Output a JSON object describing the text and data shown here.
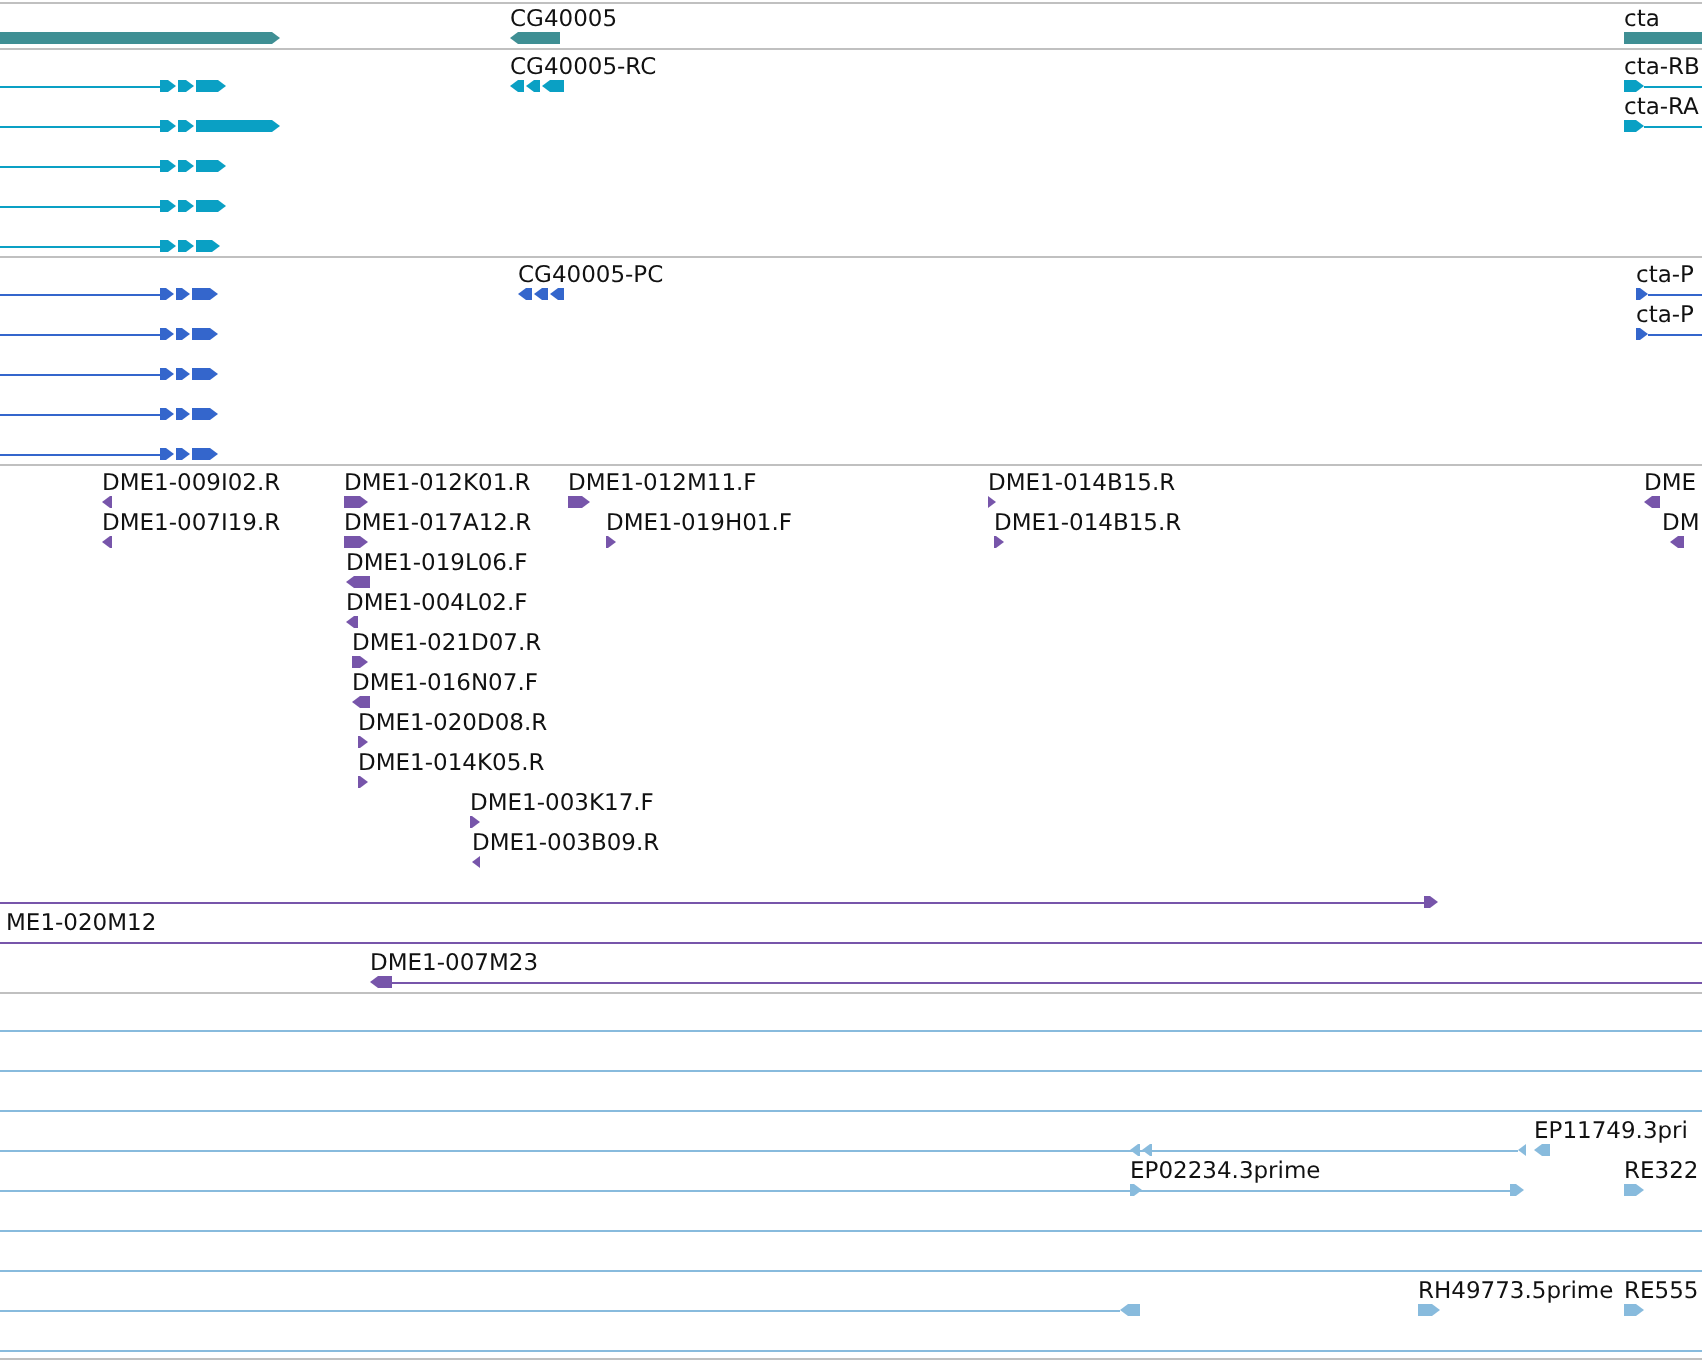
{
  "tracks": [
    {
      "kind": "gene",
      "color": "#3f8f94",
      "features": [
        {
          "reverse": false
        },
        {
          "label": "CG40005",
          "reverse": true
        },
        {
          "label": "cta"
        }
      ]
    },
    {
      "kind": "transcript",
      "color": "#0aa0c4",
      "features": [
        {
          "reverse": false
        },
        {
          "label": "CG40005-RC",
          "reverse": true
        },
        {
          "label": "cta-RB",
          "reverse": false
        },
        {
          "reverse": false
        },
        {
          "label": "cta-RA",
          "reverse": false
        },
        {
          "reverse": false
        },
        {
          "reverse": false
        },
        {
          "reverse": false
        }
      ]
    },
    {
      "kind": "protein",
      "color": "#3466cc",
      "features": [
        {
          "reverse": false
        },
        {
          "label": "CG40005-PC",
          "reverse": true
        },
        {
          "label": "cta-P",
          "reverse": false
        },
        {
          "reverse": false
        },
        {
          "label": "cta-P",
          "reverse": false
        },
        {
          "reverse": false
        },
        {
          "reverse": false
        },
        {
          "reverse": false
        }
      ]
    },
    {
      "kind": "clone",
      "color": "#7755aa",
      "features": [
        {
          "label": "DME1-009I02.R",
          "reverse": true
        },
        {
          "label": "DME1-012K01.R",
          "reverse": false
        },
        {
          "label": "DME1-012M11.F",
          "reverse": false
        },
        {
          "label": "DME1-014B15.R",
          "reverse": false
        },
        {
          "label": "DME",
          "reverse": true
        },
        {
          "label": "DME1-007I19.R",
          "reverse": true
        },
        {
          "label": "DME1-017A12.R",
          "reverse": false
        },
        {
          "label": "DME1-019H01.F",
          "reverse": false
        },
        {
          "label": "DME1-014B15.R",
          "reverse": false
        },
        {
          "label": "DM",
          "reverse": true
        },
        {
          "label": "DME1-019L06.F",
          "reverse": true
        },
        {
          "label": "DME1-004L02.F",
          "reverse": true
        },
        {
          "label": "DME1-021D07.R",
          "reverse": false
        },
        {
          "label": "DME1-016N07.F",
          "reverse": true
        },
        {
          "label": "DME1-020D08.R",
          "reverse": false
        },
        {
          "label": "DME1-014K05.R",
          "reverse": false
        },
        {
          "label": "DME1-003K17.F",
          "reverse": false
        },
        {
          "label": "DME1-003B09.R",
          "reverse": true
        },
        {
          "reverse": false
        },
        {
          "label": "ME1-020M12"
        },
        {
          "label": "DME1-007M23",
          "reverse": true
        }
      ]
    },
    {
      "kind": "est",
      "color": "#88bbdd",
      "features": [
        {
          "reverse": true
        },
        {
          "label": "EP11749.3pri",
          "reverse": true
        },
        {
          "label": "EP02234.3prime",
          "reverse": false
        },
        {
          "label": "RE322",
          "reverse": false
        },
        {
          "reverse": true
        },
        {
          "label": "RH49773.5prime",
          "reverse": false
        },
        {
          "label": "RE555",
          "reverse": false
        }
      ]
    }
  ]
}
